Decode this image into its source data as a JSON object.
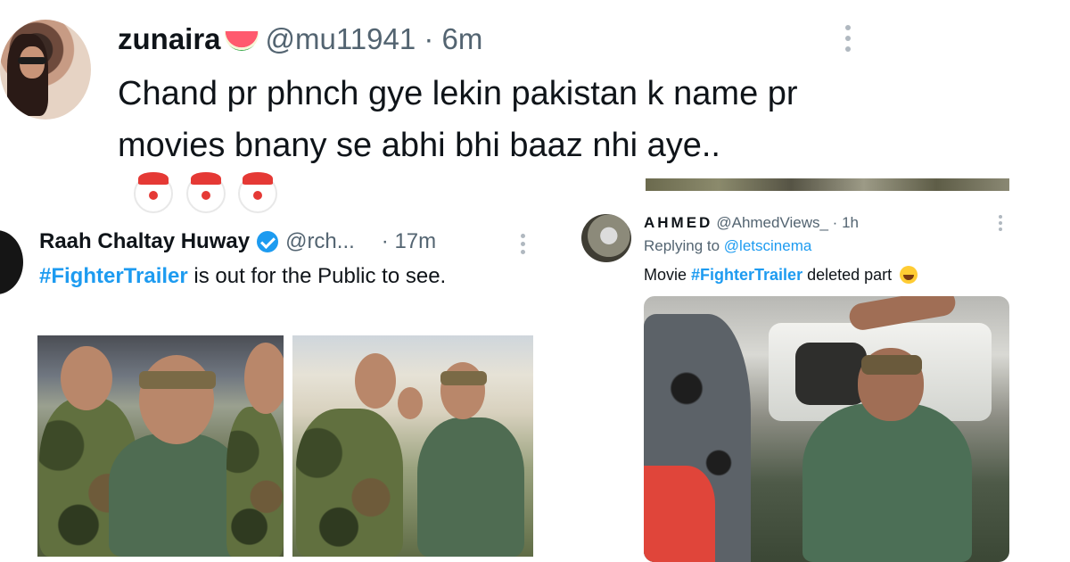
{
  "top_tweet": {
    "name": "zunaira",
    "name_emoji_icon": "watermelon-icon",
    "handle_time": "@mu11941 · 6m",
    "text": "Chand pr phnch gye lekin pakistan k name pr movies bnany se abhi bhi baaz nhi aye..",
    "trailing_emoji_icon": "clown-face-icon",
    "trailing_emoji_count": 3
  },
  "left_tweet": {
    "name": "Raah Chaltay Huway",
    "verified": true,
    "handle": "@rch...",
    "time": "· 17m",
    "hashtag": "#FighterTrailer",
    "text_rest": " is out for the Public to see.",
    "media_count": 2
  },
  "right_tweet": {
    "name": "AHMED",
    "handle_time": "@AhmedViews_ · 1h",
    "replying_prefix": "Replying to",
    "replying_to": "@letscinema",
    "text_prefix": "Movie",
    "hashtag": "#FighterTrailer",
    "text_suffix": "deleted part",
    "trailing_emoji_icon": "tears-of-joy-icon"
  },
  "colors": {
    "link": "#1d9bf0",
    "text": "#0f1419",
    "secondary": "#536471"
  }
}
